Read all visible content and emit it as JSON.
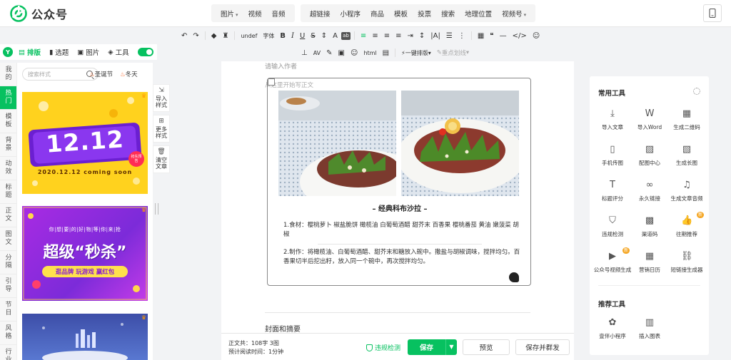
{
  "header": {
    "app_title": "公众号",
    "media_menu": [
      "图片",
      "视频",
      "音频"
    ],
    "insert_menu": [
      "超链接",
      "小程序",
      "商品",
      "模板",
      "投票",
      "搜索",
      "地理位置",
      "视频号"
    ]
  },
  "toolbar": {
    "font_size_value": "undef",
    "font_family_label": "字体",
    "one_click_layout": "一键排版",
    "focus_mark": "重点划线"
  },
  "left_panel": {
    "tabs": [
      "排版",
      "选题",
      "图片",
      "工具"
    ],
    "categories": [
      [
        "我",
        "的"
      ],
      [
        "热",
        "门"
      ],
      [
        "模",
        "板"
      ],
      [
        "背",
        "景"
      ],
      [
        "动",
        "效"
      ],
      [
        "标",
        "题"
      ],
      [
        "正",
        "文"
      ],
      [
        "图",
        "文"
      ],
      [
        "分",
        "隔"
      ],
      [
        "引",
        "导"
      ],
      [
        "节",
        "日"
      ],
      [
        "风",
        "格"
      ],
      [
        "行",
        "业"
      ]
    ],
    "active_category": 1,
    "search_placeholder": "搜索样式",
    "hot_tags": [
      "圣诞节",
      "冬天"
    ],
    "banner1": {
      "big_text": "12.12",
      "sub_text": "2020.12.12 coming soon",
      "badge": "抢先预告"
    },
    "banner2": {
      "top_text": "你|想|要|的|好|物|等|你|来|抢",
      "big_text": "超级“秒杀”",
      "ribbon": "逛品牌 玩游戏 赢红包"
    },
    "side_actions": [
      {
        "lines": [
          "导入",
          "样式"
        ]
      },
      {
        "lines": [
          "更多",
          "样式"
        ]
      },
      {
        "lines": [
          "清空",
          "文章"
        ]
      }
    ]
  },
  "editor": {
    "author_placeholder": "请输入作者",
    "body_placeholder": "从这里开始写正文",
    "dish_title": "– 经典科布沙拉 –",
    "para1": "1.食材：樱桃萝卜 椒盐脆饼 橄榄油 白葡萄酒醋 甜芥末 百香果 樱桃番茄 黄油 嫩菠菜 胡椒",
    "para2": "2.制作：将橄榄油、白葡萄酒醋、甜芥末和糖放入碗中。撒盐与胡椒调味，搅拌均匀。百香果切半后挖出籽，放入同一个碗中，再次搅拌均匀。",
    "cover_label": "封面和摘要"
  },
  "bottom": {
    "word_count_label": "正文共：",
    "word_count": "108字 3图",
    "read_time_label": "预计阅读时间：",
    "read_time": "1分钟",
    "compliance": "违规检测",
    "save": "保存",
    "preview": "预览",
    "save_and_send": "保存并群发"
  },
  "right_panel": {
    "common_title": "常用工具",
    "common_tools": [
      {
        "label": "导入文章",
        "icon": "download-icon"
      },
      {
        "label": "导入Word",
        "icon": "word-icon"
      },
      {
        "label": "生成二维码",
        "icon": "qrcode-icon"
      },
      {
        "label": "手机传图",
        "icon": "phone-icon"
      },
      {
        "label": "配图中心",
        "icon": "image-icon"
      },
      {
        "label": "生成长图",
        "icon": "long-image-icon"
      },
      {
        "label": "标题评分",
        "icon": "title-score-icon"
      },
      {
        "label": "永久链接",
        "icon": "link-icon"
      },
      {
        "label": "生成文章音频",
        "icon": "audio-icon"
      },
      {
        "label": "违规检测",
        "icon": "shield-icon"
      },
      {
        "label": "渠道码",
        "icon": "channel-code-icon"
      },
      {
        "label": "往期推荐",
        "icon": "thumb-up-icon",
        "badge": "新"
      },
      {
        "label": "公众号视频生成",
        "icon": "video-icon",
        "badge": "新"
      },
      {
        "label": "营销日历",
        "icon": "calendar-icon"
      },
      {
        "label": "短链接生成器",
        "icon": "short-link-icon"
      }
    ],
    "recommend_title": "推荐工具",
    "recommend_tools": [
      {
        "label": "壹伴小程序",
        "icon": "miniprogram-icon"
      },
      {
        "label": "插入图表",
        "icon": "chart-icon"
      }
    ]
  },
  "colors": {
    "accent": "#07c160",
    "badge": "#f5a623"
  }
}
